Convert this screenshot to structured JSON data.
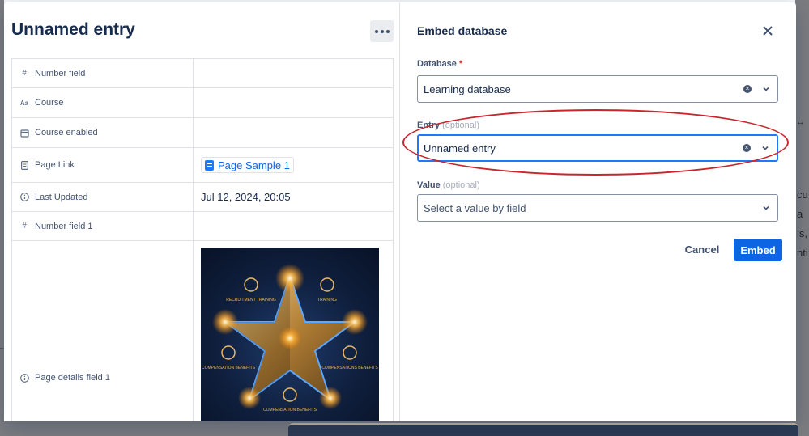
{
  "background": {
    "right_text_lines": [
      "cu",
      "a",
      "is,",
      "nti:"
    ]
  },
  "entry": {
    "title": "Unnamed entry",
    "fields": [
      {
        "label": "Number field",
        "icon": "hash-icon",
        "value": ""
      },
      {
        "label": "Course",
        "icon": "text-icon",
        "value": ""
      },
      {
        "label": "Course enabled",
        "icon": "calendar-icon",
        "value": ""
      },
      {
        "label": "Page Link",
        "icon": "page-icon",
        "value": "Page Sample 1"
      },
      {
        "label": "Last Updated",
        "icon": "info-icon",
        "value": "Jul 12, 2024, 20:05"
      },
      {
        "label": "Number field 1",
        "icon": "hash-icon",
        "value": ""
      },
      {
        "label": "Page details field 1",
        "icon": "info-icon",
        "value": ""
      }
    ],
    "image_labels": {
      "top_left": "RECRUITMENT TRAINING",
      "top_right": "TRAINING",
      "mid_left": "COMPENSATION BENEFITS",
      "mid_right": "COMPENSATIONS BENEFITS",
      "bottom": "COMPENSATION BENEFITS"
    }
  },
  "dialog": {
    "title": "Embed database",
    "database_label": "Database",
    "database_required": "*",
    "database_value": "Learning database",
    "entry_label": "Entry",
    "entry_optional": "(optional)",
    "entry_value": "Unnamed entry",
    "value_label": "Value",
    "value_optional": "(optional)",
    "value_placeholder": "Select a value by field",
    "cancel_label": "Cancel",
    "embed_label": "Embed"
  },
  "colors": {
    "primary": "#0c66e4",
    "highlight": "#c8252d",
    "text": "#172b4d"
  }
}
